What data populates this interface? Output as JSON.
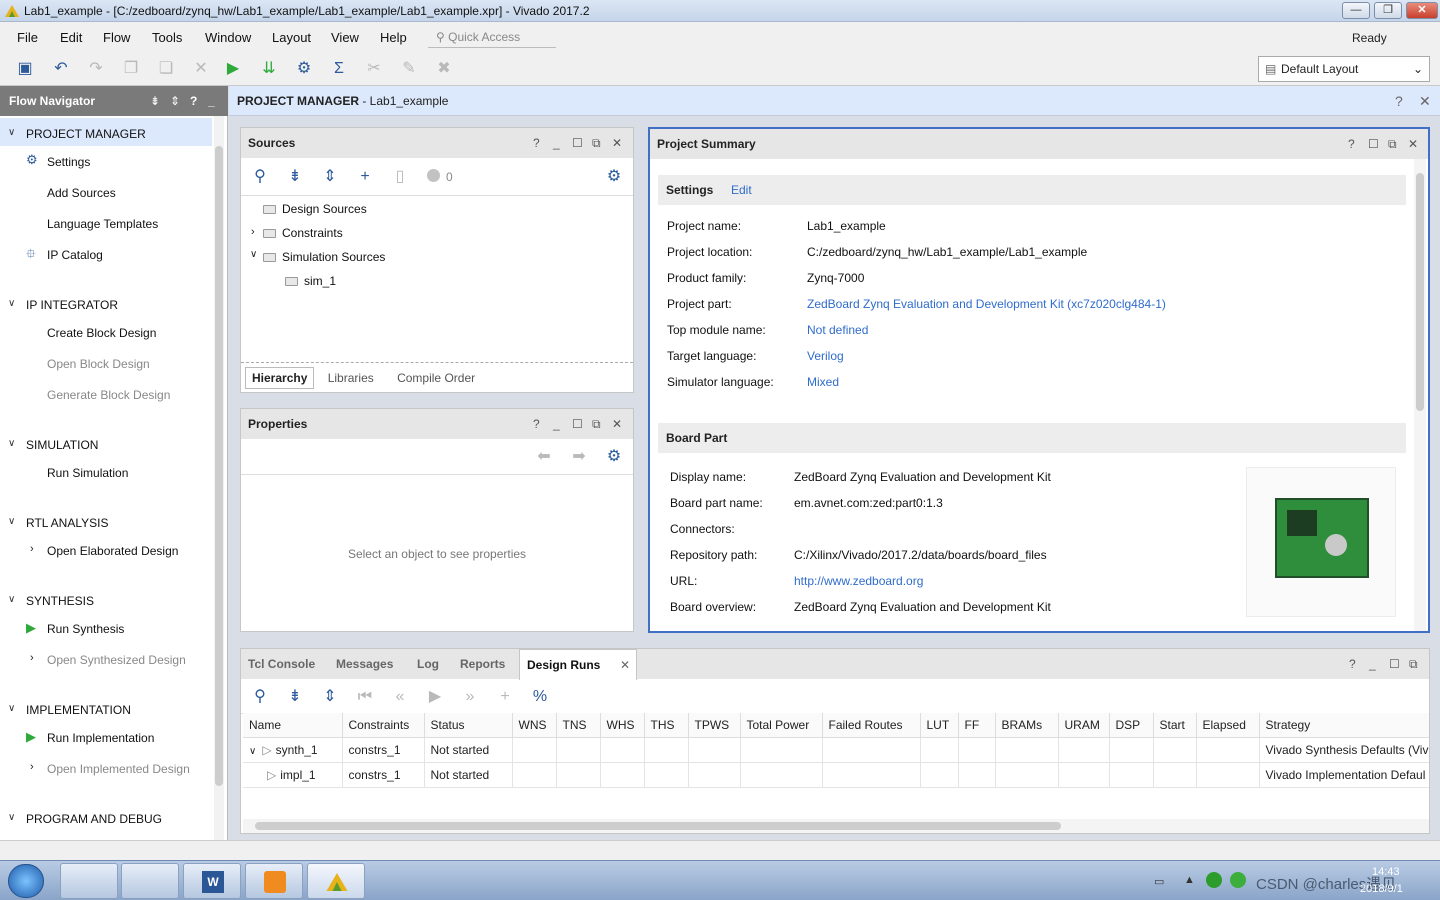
{
  "window": {
    "title": "Lab1_example - [C:/zedboard/zynq_hw/Lab1_example/Lab1_example/Lab1_example.xpr] - Vivado 2017.2",
    "min": "—",
    "max": "❐",
    "close": "✕"
  },
  "menubar": {
    "items": [
      "File",
      "Edit",
      "Flow",
      "Tools",
      "Window",
      "Layout",
      "View",
      "Help"
    ],
    "quick_access_placeholder": "Quick Access",
    "status": "Ready"
  },
  "toolbar": {
    "layout_value": "Default Layout"
  },
  "flow_navigator": {
    "title": "Flow Navigator",
    "sections": [
      {
        "label": "PROJECT MANAGER",
        "items": [
          "Settings",
          "Add Sources",
          "Language Templates",
          "IP Catalog"
        ]
      },
      {
        "label": "IP INTEGRATOR",
        "items": [
          "Create Block Design",
          "Open Block Design",
          "Generate Block Design"
        ]
      },
      {
        "label": "SIMULATION",
        "items": [
          "Run Simulation"
        ]
      },
      {
        "label": "RTL ANALYSIS",
        "items": [
          "Open Elaborated Design"
        ]
      },
      {
        "label": "SYNTHESIS",
        "items": [
          "Run Synthesis",
          "Open Synthesized Design"
        ]
      },
      {
        "label": "IMPLEMENTATION",
        "items": [
          "Run Implementation",
          "Open Implemented Design"
        ]
      },
      {
        "label": "PROGRAM AND DEBUG",
        "items": []
      }
    ]
  },
  "pm_header": {
    "bold": "PROJECT MANAGER",
    "rest": " - Lab1_example"
  },
  "sources": {
    "title": "Sources",
    "count": "0",
    "tree": [
      "Design Sources",
      "Constraints",
      "Simulation Sources",
      "sim_1"
    ],
    "tabs": [
      "Hierarchy",
      "Libraries",
      "Compile Order"
    ]
  },
  "properties": {
    "title": "Properties",
    "empty_msg": "Select an object to see properties"
  },
  "summary": {
    "title": "Project Summary",
    "settings_label": "Settings",
    "edit_label": "Edit",
    "settings": [
      {
        "k": "Project name:",
        "v": "Lab1_example"
      },
      {
        "k": "Project location:",
        "v": "C:/zedboard/zynq_hw/Lab1_example/Lab1_example"
      },
      {
        "k": "Product family:",
        "v": "Zynq-7000"
      },
      {
        "k": "Project part:",
        "v": "ZedBoard Zynq Evaluation and Development Kit (xc7z020clg484-1)"
      },
      {
        "k": "Top module name:",
        "v": "Not defined"
      },
      {
        "k": "Target language:",
        "v": "Verilog"
      },
      {
        "k": "Simulator language:",
        "v": "Mixed"
      }
    ],
    "board_label": "Board Part",
    "board": [
      {
        "k": "Display name:",
        "v": "ZedBoard Zynq Evaluation and Development Kit"
      },
      {
        "k": "Board part name:",
        "v": "em.avnet.com:zed:part0:1.3"
      },
      {
        "k": "Connectors:",
        "v": ""
      },
      {
        "k": "Repository path:",
        "v": "C:/Xilinx/Vivado/2017.2/data/boards/board_files"
      },
      {
        "k": "URL:",
        "v": "http://www.zedboard.org"
      },
      {
        "k": "Board overview:",
        "v": "ZedBoard Zynq Evaluation and Development Kit"
      }
    ]
  },
  "bottom": {
    "tabs": [
      "Tcl Console",
      "Messages",
      "Log",
      "Reports",
      "Design Runs"
    ],
    "columns": [
      "Name",
      "Constraints",
      "Status",
      "WNS",
      "TNS",
      "WHS",
      "THS",
      "TPWS",
      "Total Power",
      "Failed Routes",
      "LUT",
      "FF",
      "BRAMs",
      "URAM",
      "DSP",
      "Start",
      "Elapsed",
      "Strategy"
    ],
    "rows": [
      {
        "name": "synth_1",
        "constraints": "constrs_1",
        "status": "Not started",
        "strategy": "Vivado Synthesis Defaults (Viv"
      },
      {
        "name": "impl_1",
        "constraints": "constrs_1",
        "status": "Not started",
        "strategy": "Vivado Implementation Defaul"
      }
    ]
  },
  "taskbar": {
    "time": "14:43",
    "date": "2018/9/1",
    "watermark": "CSDN @charles遇见"
  },
  "colors": {
    "accent": "#2f6ccb",
    "selection": "#dce8fb",
    "run_green": "#2eaa3a"
  }
}
